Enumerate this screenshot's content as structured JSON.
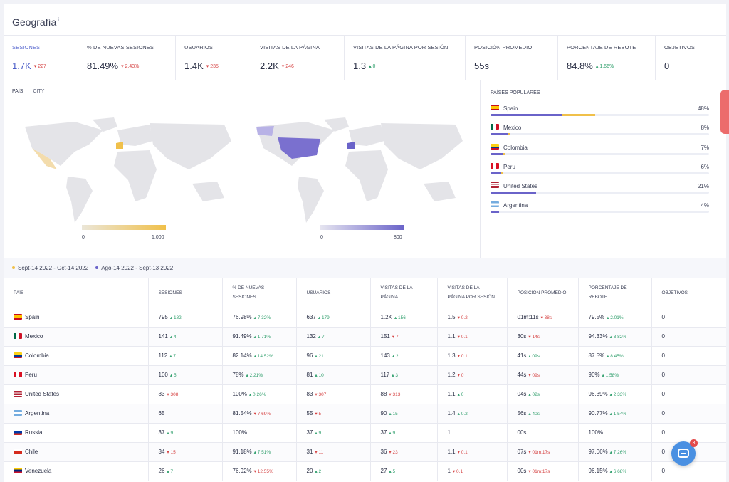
{
  "title": "Geografía",
  "title_info": "i",
  "metrics": [
    {
      "label": "Sesiones",
      "value": "1.7K",
      "delta": "227",
      "dir": "down",
      "active": true
    },
    {
      "label": "% de nuevas sesiones",
      "value": "81.49%",
      "delta": "2.43%",
      "dir": "down"
    },
    {
      "label": "Usuarios",
      "value": "1.4K",
      "delta": "235",
      "dir": "down"
    },
    {
      "label": "Visitas de la página",
      "value": "2.2K",
      "delta": "246",
      "dir": "down"
    },
    {
      "label": "Visitas de la página por sesión",
      "value": "1.3",
      "delta": "0",
      "dir": "up"
    },
    {
      "label": "Posición promedio",
      "value": "55s",
      "delta": "",
      "dir": ""
    },
    {
      "label": "Porcentaje de rebote",
      "value": "84.8%",
      "delta": "1.66%",
      "dir": "up"
    },
    {
      "label": "Objetivos",
      "value": "0",
      "delta": "",
      "dir": ""
    }
  ],
  "tabs": [
    "País",
    "City"
  ],
  "map_left": {
    "legend_min": "0",
    "legend_max": "1,000",
    "color": "#f0c04a"
  },
  "map_right": {
    "legend_min": "0",
    "legend_max": "800",
    "color": "#6a63c9"
  },
  "popular": {
    "title": "Países populares",
    "items": [
      {
        "name": "Spain",
        "pct": "48%",
        "cur": 0.33,
        "prev": 0.48,
        "flag": "es"
      },
      {
        "name": "Mexico",
        "pct": "8%",
        "cur": 0.08,
        "prev": 0.09,
        "flag": "mx"
      },
      {
        "name": "Colombia",
        "pct": "7%",
        "cur": 0.06,
        "prev": 0.07,
        "flag": "co"
      },
      {
        "name": "Peru",
        "pct": "6%",
        "cur": 0.05,
        "prev": 0.06,
        "flag": "pe"
      },
      {
        "name": "United States",
        "pct": "21%",
        "cur": 0.21,
        "prev": 0.05,
        "flag": "us"
      },
      {
        "name": "Argentina",
        "pct": "4%",
        "cur": 0.04,
        "prev": 0.04,
        "flag": "ar"
      }
    ]
  },
  "dates": {
    "current": "Sept-14 2022 - Oct-14 2022",
    "previous": "Ago-14 2022 - Sept-13 2022",
    "current_color": "#f0c04a",
    "previous_color": "#6a63c9"
  },
  "table": {
    "headers": [
      "País",
      "Sesiones",
      "% de nuevas sesiones",
      "Usuarios",
      "Visitas de la página",
      "Visitas de la página por sesión",
      "Posición promedio",
      "Porcentaje de rebote",
      "Objetivos"
    ],
    "rows": [
      {
        "flag": "es",
        "cells": [
          [
            "Spain",
            "",
            ""
          ],
          [
            "795",
            "182",
            "up"
          ],
          [
            "76.98%",
            "7.32%",
            "up"
          ],
          [
            "637",
            "179",
            "up"
          ],
          [
            "1.2K",
            "156",
            "up"
          ],
          [
            "1.5",
            "0.2",
            "down"
          ],
          [
            "01m:11s",
            "38s",
            "down"
          ],
          [
            "79.5%",
            "2.01%",
            "up"
          ],
          [
            "0",
            "",
            ""
          ]
        ]
      },
      {
        "flag": "mx",
        "cells": [
          [
            "Mexico",
            "",
            ""
          ],
          [
            "141",
            "4",
            "up"
          ],
          [
            "91.49%",
            "1.71%",
            "up"
          ],
          [
            "132",
            "7",
            "up"
          ],
          [
            "151",
            "7",
            "down"
          ],
          [
            "1.1",
            "0.1",
            "down"
          ],
          [
            "30s",
            "14s",
            "down"
          ],
          [
            "94.33%",
            "3.82%",
            "up"
          ],
          [
            "0",
            "",
            ""
          ]
        ]
      },
      {
        "flag": "co",
        "cells": [
          [
            "Colombia",
            "",
            ""
          ],
          [
            "112",
            "7",
            "up"
          ],
          [
            "82.14%",
            "14.52%",
            "up"
          ],
          [
            "96",
            "21",
            "up"
          ],
          [
            "143",
            "2",
            "up"
          ],
          [
            "1.3",
            "0.1",
            "down"
          ],
          [
            "41s",
            "09s",
            "up"
          ],
          [
            "87.5%",
            "8.45%",
            "up"
          ],
          [
            "0",
            "",
            ""
          ]
        ]
      },
      {
        "flag": "pe",
        "cells": [
          [
            "Peru",
            "",
            ""
          ],
          [
            "100",
            "5",
            "up"
          ],
          [
            "78%",
            "2.21%",
            "up"
          ],
          [
            "81",
            "10",
            "up"
          ],
          [
            "117",
            "3",
            "up"
          ],
          [
            "1.2",
            "0",
            "down"
          ],
          [
            "44s",
            "09s",
            "down"
          ],
          [
            "90%",
            "1.58%",
            "up"
          ],
          [
            "0",
            "",
            ""
          ]
        ]
      },
      {
        "flag": "us",
        "cells": [
          [
            "United States",
            "",
            ""
          ],
          [
            "83",
            "308",
            "down"
          ],
          [
            "100%",
            "0.26%",
            "up"
          ],
          [
            "83",
            "307",
            "down"
          ],
          [
            "88",
            "313",
            "down"
          ],
          [
            "1.1",
            "0",
            "up"
          ],
          [
            "04s",
            "02s",
            "up"
          ],
          [
            "96.39%",
            "2.33%",
            "up"
          ],
          [
            "0",
            "",
            ""
          ]
        ]
      },
      {
        "flag": "ar",
        "cells": [
          [
            "Argentina",
            "",
            ""
          ],
          [
            "65",
            "",
            ""
          ],
          [
            "81.54%",
            "7.69%",
            "down"
          ],
          [
            "55",
            "5",
            "down"
          ],
          [
            "90",
            "15",
            "up"
          ],
          [
            "1.4",
            "0.2",
            "up"
          ],
          [
            "56s",
            "40s",
            "up"
          ],
          [
            "90.77%",
            "1.54%",
            "up"
          ],
          [
            "0",
            "",
            ""
          ]
        ]
      },
      {
        "flag": "ru",
        "cells": [
          [
            "Russia",
            "",
            ""
          ],
          [
            "37",
            "9",
            "up"
          ],
          [
            "100%",
            "",
            ""
          ],
          [
            "37",
            "9",
            "up"
          ],
          [
            "37",
            "9",
            "up"
          ],
          [
            "1",
            "",
            ""
          ],
          [
            "00s",
            "",
            ""
          ],
          [
            "100%",
            "",
            ""
          ],
          [
            "0",
            "",
            ""
          ]
        ]
      },
      {
        "flag": "cl",
        "cells": [
          [
            "Chile",
            "",
            ""
          ],
          [
            "34",
            "15",
            "down"
          ],
          [
            "91.18%",
            "7.51%",
            "up"
          ],
          [
            "31",
            "11",
            "down"
          ],
          [
            "36",
            "23",
            "down"
          ],
          [
            "1.1",
            "0.1",
            "down"
          ],
          [
            "07s",
            "01m:17s",
            "down"
          ],
          [
            "97.06%",
            "7.26%",
            "up"
          ],
          [
            "0",
            "",
            ""
          ]
        ]
      },
      {
        "flag": "ve",
        "cells": [
          [
            "Venezuela",
            "",
            ""
          ],
          [
            "26",
            "7",
            "up"
          ],
          [
            "76.92%",
            "12.55%",
            "down"
          ],
          [
            "20",
            "2",
            "up"
          ],
          [
            "27",
            "5",
            "up"
          ],
          [
            "1",
            "0.1",
            "down"
          ],
          [
            "00s",
            "01m:17s",
            "down"
          ],
          [
            "96.15%",
            "6.68%",
            "up"
          ],
          [
            "0",
            "",
            ""
          ]
        ]
      }
    ]
  },
  "chat_badge": "3"
}
